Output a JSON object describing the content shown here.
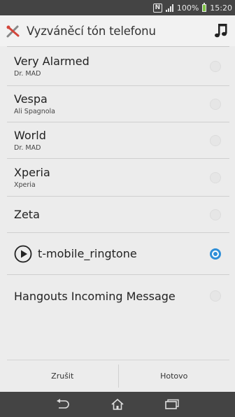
{
  "status_bar": {
    "nfc_label": "N",
    "battery_text": "100%",
    "time": "15:20"
  },
  "header": {
    "title": "Vyzváněcí tón telefonu",
    "left_icon": "ringtone-tools-icon",
    "right_icon": "music-note-icon"
  },
  "ringtones": [
    {
      "title": "Very Alarmed",
      "subtitle": "Dr. MAD",
      "selected": false
    },
    {
      "title": "Vespa",
      "subtitle": "Ali Spagnola",
      "selected": false
    },
    {
      "title": "World",
      "subtitle": "Dr. MAD",
      "selected": false
    },
    {
      "title": "Xperia",
      "subtitle": "Xperia",
      "selected": false
    },
    {
      "title": "Zeta",
      "selected": false
    },
    {
      "title": "t-mobile_ringtone",
      "selected": true,
      "icon": "play-icon"
    },
    {
      "title": "Hangouts Incoming Message",
      "selected": false
    }
  ],
  "buttons": {
    "cancel_label": "Zrušit",
    "done_label": "Hotovo"
  },
  "nav": {
    "icons": [
      "back-icon",
      "home-icon",
      "recent-apps-icon"
    ]
  },
  "colors": {
    "accent": "#2f8fd8",
    "status_bar": "#444444",
    "battery": "#7ec344"
  }
}
